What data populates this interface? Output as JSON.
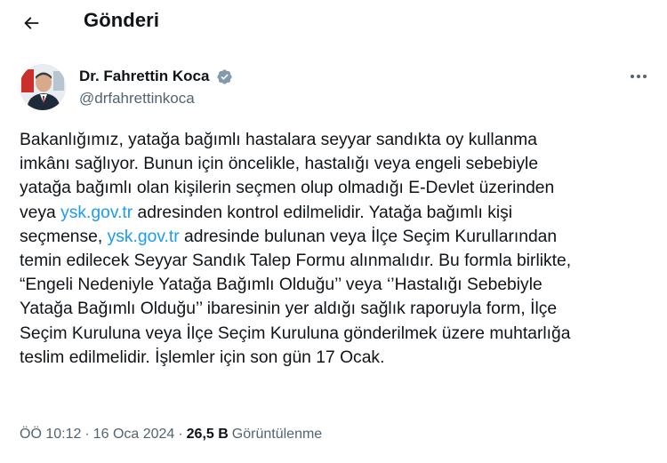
{
  "header": {
    "title": "Gönderi"
  },
  "author": {
    "name": "Dr. Fahrettin Koca",
    "handle": "@drfahrettinkoca",
    "verified": true
  },
  "tweet": {
    "lines": [
      [
        {
          "t": "Bakanlığımız, yatağa bağımlı hastalara seyyar sandıkta oy kullanma"
        }
      ],
      [
        {
          "t": "imkânı sağlıyor. Bunun için öncelikle, hastalığı veya engeli sebebiyle"
        }
      ],
      [
        {
          "t": "yatağa bağımlı olan kişilerin seçmen olup olmadığı E-Devlet üzerinden"
        }
      ],
      [
        {
          "t": "veya "
        },
        {
          "t": "ysk.gov.tr",
          "link": true
        },
        {
          "t": " adresinden kontrol edilmelidir. Yatağa bağımlı kişi"
        }
      ],
      [
        {
          "t": "seçmense, "
        },
        {
          "t": "ysk.gov.tr",
          "link": true
        },
        {
          "t": " adresinde bulunan veya İlçe Seçim Kurullarından"
        }
      ],
      [
        {
          "t": "temin edilecek Seyyar Sandık Talep Formu alınmalıdır. Bu formla birlikte,"
        }
      ],
      [
        {
          "t": "“Engeli Nedeniyle Yatağa Bağımlı Olduğu’’ veya ‘’Hastalığı Sebebiyle"
        }
      ],
      [
        {
          "t": "Yatağa Bağımlı Olduğu’’ ibaresinin yer aldığı sağlık raporuyla form, İlçe"
        }
      ],
      [
        {
          "t": "Seçim Kuruluna veya İlçe Seçim Kuruluna gönderilmek üzere muhtarlığa"
        }
      ],
      [
        {
          "t": "teslim edilmelidir. İşlemler için son gün 17 Ocak."
        }
      ]
    ]
  },
  "meta": {
    "time": "ÖÖ 10:12",
    "separator": "·",
    "date": "16 Oca 2024",
    "views_count": "26,5 B",
    "views_label": "Görüntülenme"
  },
  "colors": {
    "text": "#0f1419",
    "secondary": "#536471",
    "link": "#1d9bf0",
    "verified_badge": "#829aab"
  },
  "icons": {
    "back": "arrow-left-icon",
    "verified": "verified-badge-icon",
    "more": "more-horizontal-icon"
  }
}
